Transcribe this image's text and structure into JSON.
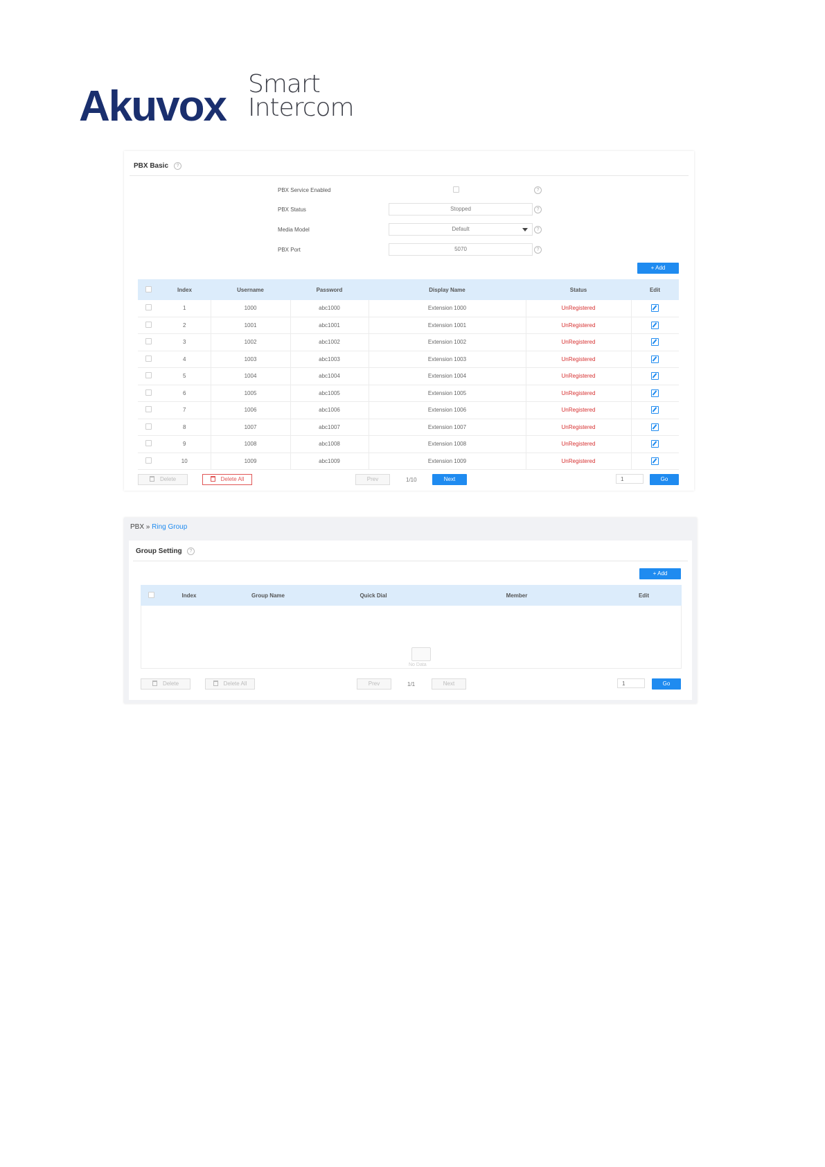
{
  "logo": {
    "brand": "Akuvox",
    "tagline_1": "Smart",
    "tagline_2": "Intercom"
  },
  "pbx_basic": {
    "title": "PBX Basic",
    "fields": {
      "service_enabled_label": "PBX Service Enabled",
      "status_label": "PBX Status",
      "status_value": "Stopped",
      "media_model_label": "Media Model",
      "media_model_value": "Default",
      "port_label": "PBX Port",
      "port_value": "5070"
    },
    "add_label": "+  Add",
    "columns": [
      "Index",
      "Username",
      "Password",
      "Display Name",
      "Status",
      "Edit"
    ],
    "rows": [
      {
        "index": "1",
        "username": "1000",
        "password": "abc1000",
        "display": "Extension 1000",
        "status": "UnRegistered"
      },
      {
        "index": "2",
        "username": "1001",
        "password": "abc1001",
        "display": "Extension 1001",
        "status": "UnRegistered"
      },
      {
        "index": "3",
        "username": "1002",
        "password": "abc1002",
        "display": "Extension 1002",
        "status": "UnRegistered"
      },
      {
        "index": "4",
        "username": "1003",
        "password": "abc1003",
        "display": "Extension 1003",
        "status": "UnRegistered"
      },
      {
        "index": "5",
        "username": "1004",
        "password": "abc1004",
        "display": "Extension 1004",
        "status": "UnRegistered"
      },
      {
        "index": "6",
        "username": "1005",
        "password": "abc1005",
        "display": "Extension 1005",
        "status": "UnRegistered"
      },
      {
        "index": "7",
        "username": "1006",
        "password": "abc1006",
        "display": "Extension 1006",
        "status": "UnRegistered"
      },
      {
        "index": "8",
        "username": "1007",
        "password": "abc1007",
        "display": "Extension 1007",
        "status": "UnRegistered"
      },
      {
        "index": "9",
        "username": "1008",
        "password": "abc1008",
        "display": "Extension 1008",
        "status": "UnRegistered"
      },
      {
        "index": "10",
        "username": "1009",
        "password": "abc1009",
        "display": "Extension 1009",
        "status": "UnRegistered"
      }
    ],
    "pager": {
      "delete": "Delete",
      "delete_all": "Delete All",
      "prev": "Prev",
      "page": "1/10",
      "next": "Next",
      "page_input": "1",
      "go": "Go"
    }
  },
  "ring_group": {
    "breadcrumb_root": "PBX",
    "breadcrumb_sep": "»",
    "breadcrumb_current": "Ring Group",
    "title": "Group Setting",
    "add_label": "+  Add",
    "columns": [
      "Index",
      "Group Name",
      "Quick Dial",
      "Member",
      "Edit"
    ],
    "no_data": "No Data",
    "pager": {
      "delete": "Delete",
      "delete_all": "Delete All",
      "prev": "Prev",
      "page": "1/1",
      "next": "Next",
      "page_input": "1",
      "go": "Go"
    }
  }
}
